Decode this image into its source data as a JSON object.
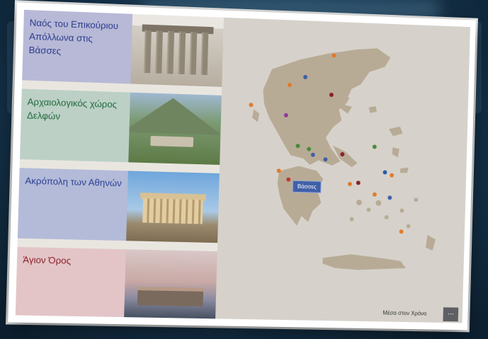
{
  "sites": [
    {
      "label": "Ναός του Επικούριου Απόλλωνα στις Βάσσες",
      "photo": "temple-of-apollo-photo"
    },
    {
      "label": "Αρχαιολογικός χώρος Δελφών",
      "photo": "delphi-photo"
    },
    {
      "label": "Ακρόπολη των Αθηνών",
      "photo": "acropolis-photo"
    },
    {
      "label": "Άγιον Όρος",
      "photo": "mount-athos-photo"
    }
  ],
  "map": {
    "popup_label": "Βάσσες",
    "markers": [
      {
        "color": "#e07a2a"
      },
      {
        "color": "#3f5fa8"
      },
      {
        "color": "#e07a2a"
      },
      {
        "color": "#8a1f2a"
      },
      {
        "color": "#e07a2a"
      },
      {
        "color": "#8e3a9a"
      },
      {
        "color": "#4a8a3a"
      },
      {
        "color": "#4a8a3a"
      },
      {
        "color": "#3f5fa8"
      },
      {
        "color": "#3f5fa8"
      },
      {
        "color": "#8a1f2a"
      },
      {
        "color": "#4a8a3a"
      },
      {
        "color": "#e07a2a"
      },
      {
        "color": "#c0392b"
      },
      {
        "color": "#e07a2a"
      },
      {
        "color": "#8a1f2a"
      },
      {
        "color": "#2a5aa8"
      },
      {
        "color": "#e07a2a"
      },
      {
        "color": "#e07a2a"
      },
      {
        "color": "#3f5fa8"
      },
      {
        "color": "#e07a2a"
      }
    ]
  },
  "footer": {
    "title": "Μέσα στον Χρόνο",
    "more_label": "..."
  },
  "reflection_text": "Άγιον Όρος",
  "colors": {
    "accent": "#3f5fa8",
    "map_land": "#b8ab96",
    "map_sea": "#d6d2cb"
  }
}
